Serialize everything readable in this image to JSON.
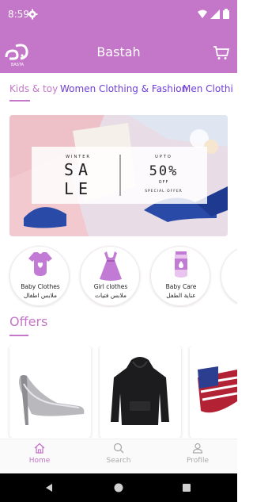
{
  "status_bar": {
    "time": "8:59"
  },
  "app_bar": {
    "title": "Bastah",
    "logo_text": "BASTA"
  },
  "tabs": [
    {
      "label": "Kids & toy"
    },
    {
      "label": "Women Clothing & Fashion"
    },
    {
      "label": "Men Clothi"
    }
  ],
  "banner": {
    "left_small": "WINTER",
    "left_big_1": "SA",
    "left_big_2": "LE",
    "right_small": "UPTO",
    "right_big": "50%",
    "right_off": "OFF",
    "right_bottom": "SPECIAL OFFER"
  },
  "categories": [
    {
      "name_en": "Baby Clothes",
      "name_ar": "ملابس اطفال",
      "icon": "baby-bodysuit-icon"
    },
    {
      "name_en": "Girl clothes",
      "name_ar": "ملابس فتيات",
      "icon": "dress-icon"
    },
    {
      "name_en": "Baby Care",
      "name_ar": "عناية الطفل",
      "icon": "lotion-tube-icon"
    }
  ],
  "offers": {
    "title": "Offers"
  },
  "bottom_nav": [
    {
      "label": "Home",
      "icon": "home-icon"
    },
    {
      "label": "Search",
      "icon": "search-icon"
    },
    {
      "label": "Profile",
      "icon": "profile-icon"
    }
  ],
  "colors": {
    "brand": "#c476c8",
    "tab_text": "#6e3fd8"
  }
}
